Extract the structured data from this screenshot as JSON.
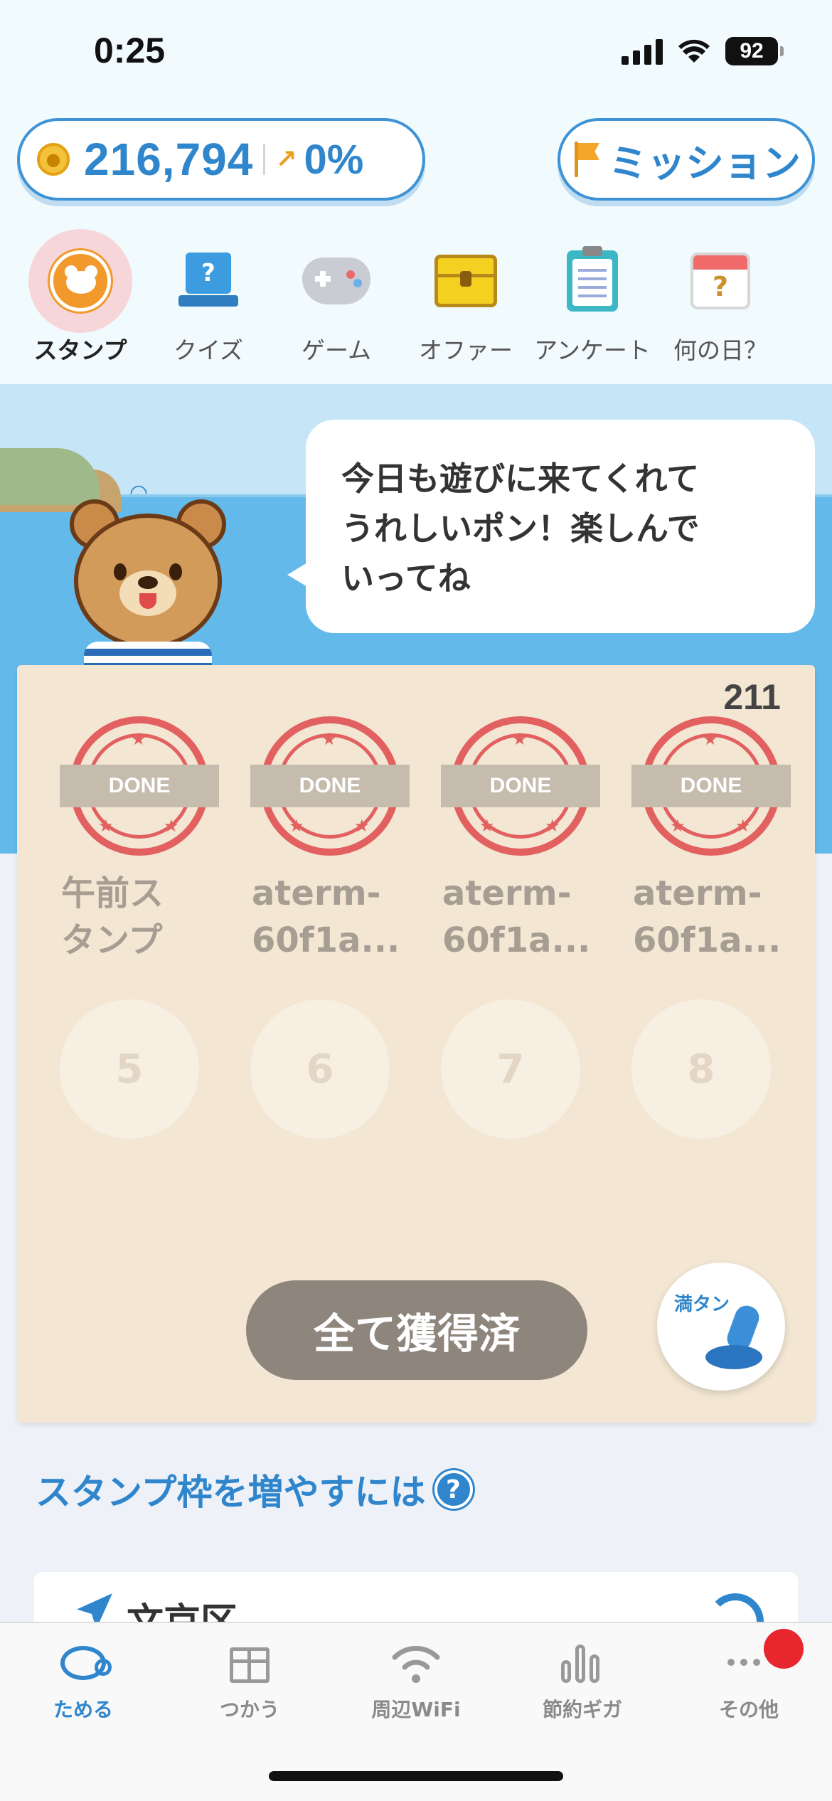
{
  "status_bar": {
    "time": "0:25",
    "battery": "92"
  },
  "header": {
    "points": "216,794",
    "trend": "0%",
    "mission_label": "ミッション"
  },
  "categories": [
    {
      "label": "スタンプ",
      "icon": "bear-stamp-icon",
      "active": true
    },
    {
      "label": "クイズ",
      "icon": "quiz-icon"
    },
    {
      "label": "ゲーム",
      "icon": "game-controller-icon"
    },
    {
      "label": "オファー",
      "icon": "treasure-chest-icon"
    },
    {
      "label": "アンケート",
      "icon": "clipboard-icon"
    },
    {
      "label": "何の日？",
      "icon": "calendar-question-icon"
    }
  ],
  "speech_bubble": {
    "line1": "今日も遊びに来てくれて",
    "line2": "うれしいポン！楽しんで",
    "line3": "いってね"
  },
  "stamp_card": {
    "count": "211",
    "done_label": "DONE",
    "completed": [
      {
        "label": "午前ス\nタンプ"
      },
      {
        "label": "aterm-\n60f1a..."
      },
      {
        "label": "aterm-\n60f1a..."
      },
      {
        "label": "aterm-\n60f1a..."
      }
    ],
    "empty_slots": [
      "5",
      "6",
      "7",
      "8"
    ],
    "claim_button": "全て獲得済",
    "fulltank_label": "満タン"
  },
  "section": {
    "title": "スタンプ枠を増やすには",
    "help_icon": "?",
    "area_name": "文京区"
  },
  "tabs": [
    {
      "label": "ためる",
      "active": true
    },
    {
      "label": "つかう"
    },
    {
      "label": "周辺WiFi"
    },
    {
      "label": "節約ギガ"
    },
    {
      "label": "その他"
    }
  ],
  "colors": {
    "accent": "#2f86cc",
    "stamp_red": "#e26060",
    "card_bg": "#f3e6d3",
    "claim_button": "#8e857c",
    "notification": "#e8262e"
  }
}
